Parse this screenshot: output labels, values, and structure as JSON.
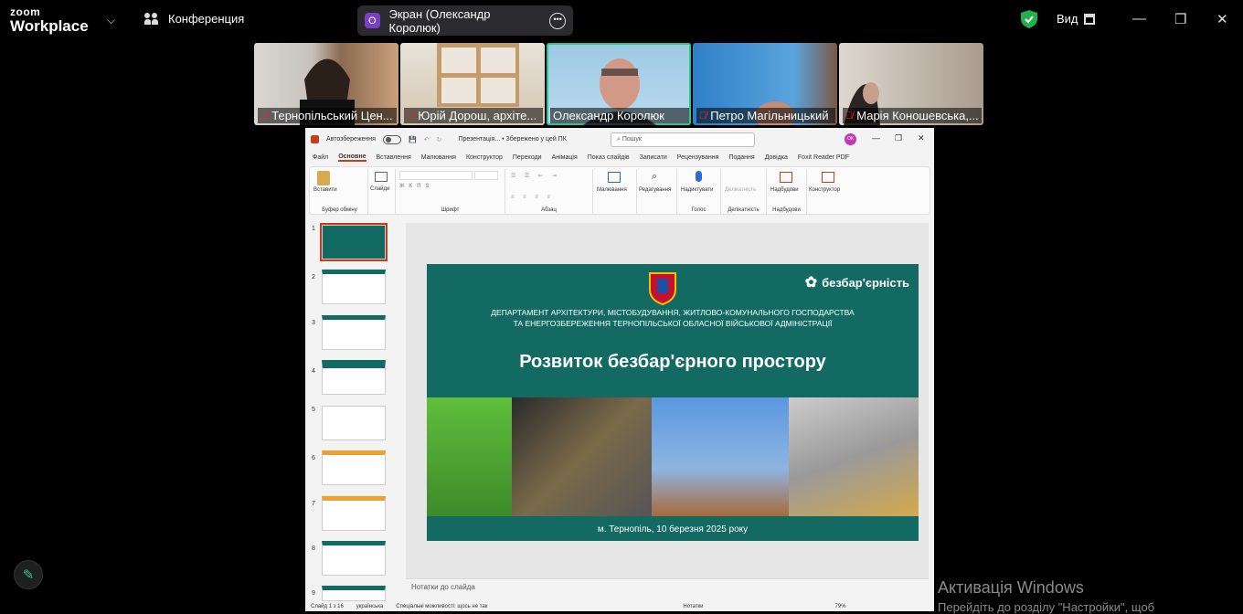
{
  "app": {
    "logo_line1": "zoom",
    "logo_line2": "Workplace"
  },
  "meeting": {
    "title": "Конференция"
  },
  "share": {
    "avatar_letter": "О",
    "label": "Экран (Олександр Королюк)"
  },
  "view": {
    "label": "Вид"
  },
  "participants": [
    {
      "name": "Тернопільський Цен...",
      "muted": true
    },
    {
      "name": "Юрій Дорош, архіте...",
      "muted": true
    },
    {
      "name": "Олександр Королюк",
      "muted": false,
      "active": true
    },
    {
      "name": "Петро Магільницький",
      "muted": true
    },
    {
      "name": "Марія Коношевська,...",
      "muted": true
    }
  ],
  "ppt": {
    "autosave": "Автозбереження",
    "filename": "Презентація... • Збережено у цей ПК",
    "search_placeholder": "Пошук",
    "user_initials": "ОК",
    "tabs": [
      "Файл",
      "Основне",
      "Вставлення",
      "Малювання",
      "Конструктор",
      "Переходи",
      "Анімація",
      "Показ слайдів",
      "Записати",
      "Рецензування",
      "Подання",
      "Довідка",
      "Foxit Reader PDF"
    ],
    "ribbon": {
      "paste": "Вставити",
      "clipboard": "Буфер обміну",
      "slides": "Слайди",
      "font": "Шрифт",
      "paragraph": "Абзац",
      "drawing": "Малювання",
      "editing": "Редагування",
      "dictate": "Надиктувати",
      "voice": "Голос",
      "sensitivity": "Делікатність",
      "addins": "Надбудови",
      "designer": "Конструктор",
      "editing_tooltip": "Редагування"
    },
    "slide_numbers": [
      "1",
      "2",
      "3",
      "4",
      "5",
      "6",
      "7",
      "8",
      "9"
    ],
    "notes_placeholder": "Нотатки до слайда",
    "status": {
      "slide": "Слайд 1 з 16",
      "lang": "українська",
      "accessibility": "Спеціальні можливості: щось не так",
      "notes_btn": "Нотатки",
      "zoom": "79%"
    }
  },
  "slide": {
    "brand": "безбар'єрність",
    "department": "ДЕПАРТАМЕНТ АРХІТЕКТУРИ, МІСТОБУДУВАННЯ, ЖИТЛОВО-КОМУНАЛЬНОГО ГОСПОДАРСТВА",
    "department2": "ТА ЕНЕРГОЗБЕРЕЖЕННЯ ТЕРНОПІЛЬСЬКОЇ ОБЛАСНОЇ ВІЙСЬКОВОЇ АДМІНІСТРАЦІЇ",
    "title": "Розвиток безбар'єрного простору",
    "date": "м. Тернопіль, 10 березня 2025 року"
  },
  "windows": {
    "activation_title": "Активація Windows",
    "activation_text": "Перейдіть до розділу \"Настройки\", щоб"
  }
}
